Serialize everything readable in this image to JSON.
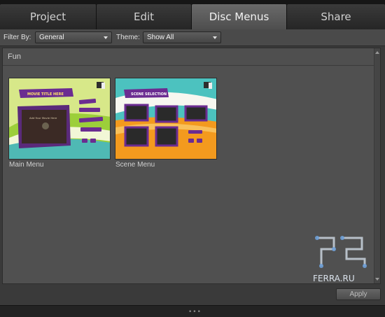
{
  "tabs": [
    {
      "label": "Project"
    },
    {
      "label": "Edit"
    },
    {
      "label": "Disc Menus",
      "active": true
    },
    {
      "label": "Share"
    }
  ],
  "filter": {
    "filter_label": "Filter By:",
    "filter_value": "General",
    "theme_label": "Theme:",
    "theme_value": "Show All"
  },
  "category": "Fun",
  "templates": [
    {
      "caption": "Main Menu",
      "title_banner": "MOVIE TITLE HERE",
      "screen_text": "Add Your Movie Here"
    },
    {
      "caption": "Scene Menu",
      "title_banner": "SCENE SELECTION"
    }
  ],
  "apply_label": "Apply",
  "watermark_text": "FERRA.RU",
  "colors": {
    "accent_purple": "#6b2c91",
    "thumb_green": "#b6d84a",
    "thumb_orange": "#f39a1e",
    "thumb_teal": "#4cc2bf"
  }
}
